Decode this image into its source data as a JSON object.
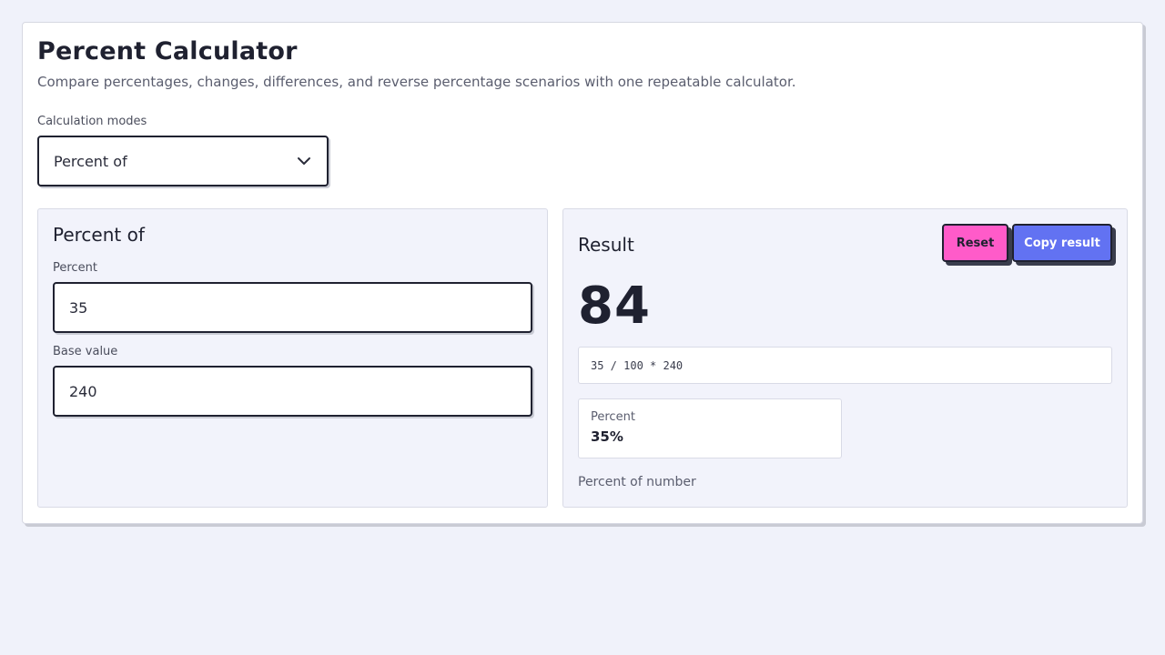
{
  "header": {
    "title": "Percent Calculator",
    "subtitle": "Compare percentages, changes, differences, and reverse percentage scenarios with one repeatable calculator."
  },
  "mode_select": {
    "label": "Calculation modes",
    "selected": "Percent of",
    "icon": "chevron-down-icon"
  },
  "inputs_panel": {
    "title": "Percent of",
    "fields": [
      {
        "label": "Percent",
        "value": "35"
      },
      {
        "label": "Base value",
        "value": "240"
      }
    ]
  },
  "result_panel": {
    "title": "Result",
    "reset_label": "Reset",
    "copy_label": "Copy result",
    "value": "84",
    "formula": "35 / 100 * 240",
    "stat": {
      "label": "Percent",
      "value": "35%"
    },
    "note": "Percent of number"
  },
  "colors": {
    "reset_button": "#ff5bc9",
    "copy_button": "#6272f2",
    "background": "#f0f2fa"
  }
}
